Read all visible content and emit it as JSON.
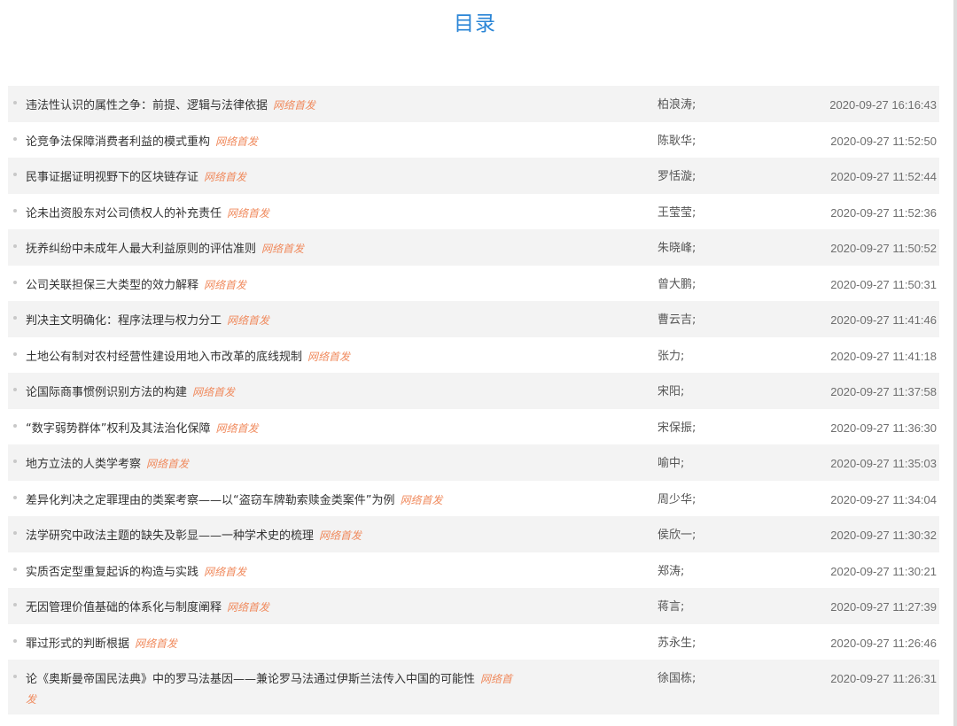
{
  "page": {
    "title": "目录"
  },
  "articles": [
    {
      "title": "违法性认识的属性之争：前提、逻辑与法律依据",
      "tag": "网络首发",
      "author": "柏浪涛;",
      "time": "2020-09-27 16:16:43"
    },
    {
      "title": "论竞争法保障消费者利益的模式重构",
      "tag": "网络首发",
      "author": "陈耿华;",
      "time": "2020-09-27 11:52:50"
    },
    {
      "title": "民事证据证明视野下的区块链存证",
      "tag": "网络首发",
      "author": "罗恬漩;",
      "time": "2020-09-27 11:52:44"
    },
    {
      "title": "论未出资股东对公司债权人的补充责任",
      "tag": "网络首发",
      "author": "王莹莹;",
      "time": "2020-09-27 11:52:36"
    },
    {
      "title": "抚养纠纷中未成年人最大利益原则的评估准则",
      "tag": "网络首发",
      "author": "朱晓峰;",
      "time": "2020-09-27 11:50:52"
    },
    {
      "title": "公司关联担保三大类型的效力解释",
      "tag": "网络首发",
      "author": "曾大鹏;",
      "time": "2020-09-27 11:50:31"
    },
    {
      "title": "判决主文明确化：程序法理与权力分工",
      "tag": "网络首发",
      "author": "曹云吉;",
      "time": "2020-09-27 11:41:46"
    },
    {
      "title": "土地公有制对农村经营性建设用地入市改革的底线规制",
      "tag": "网络首发",
      "author": "张力;",
      "time": "2020-09-27 11:41:18"
    },
    {
      "title": "论国际商事惯例识别方法的构建",
      "tag": "网络首发",
      "author": "宋阳;",
      "time": "2020-09-27 11:37:58"
    },
    {
      "title": "“数字弱势群体”权利及其法治化保障",
      "tag": "网络首发",
      "author": "宋保振;",
      "time": "2020-09-27 11:36:30"
    },
    {
      "title": "地方立法的人类学考察",
      "tag": "网络首发",
      "author": "喻中;",
      "time": "2020-09-27 11:35:03"
    },
    {
      "title": "差异化判决之定罪理由的类案考察——以“盗窃车牌勒索赎金类案件”为例",
      "tag": "网络首发",
      "author": "周少华;",
      "time": "2020-09-27 11:34:04"
    },
    {
      "title": "法学研究中政法主题的缺失及彰显——一种学术史的梳理",
      "tag": "网络首发",
      "author": "侯欣一;",
      "time": "2020-09-27 11:30:32"
    },
    {
      "title": "实质否定型重复起诉的构造与实践",
      "tag": "网络首发",
      "author": "郑涛;",
      "time": "2020-09-27 11:30:21"
    },
    {
      "title": "无因管理价值基础的体系化与制度阐释",
      "tag": "网络首发",
      "author": "蒋言;",
      "time": "2020-09-27 11:27:39"
    },
    {
      "title": "罪过形式的判断根据",
      "tag": "网络首发",
      "author": "苏永生;",
      "time": "2020-09-27 11:26:46"
    },
    {
      "title": "论《奥斯曼帝国民法典》中的罗马法基因——兼论罗马法通过伊斯兰法传入中国的可能性",
      "tag": "网络首发",
      "author": "徐国栋;",
      "time": "2020-09-27 11:26:31"
    }
  ]
}
